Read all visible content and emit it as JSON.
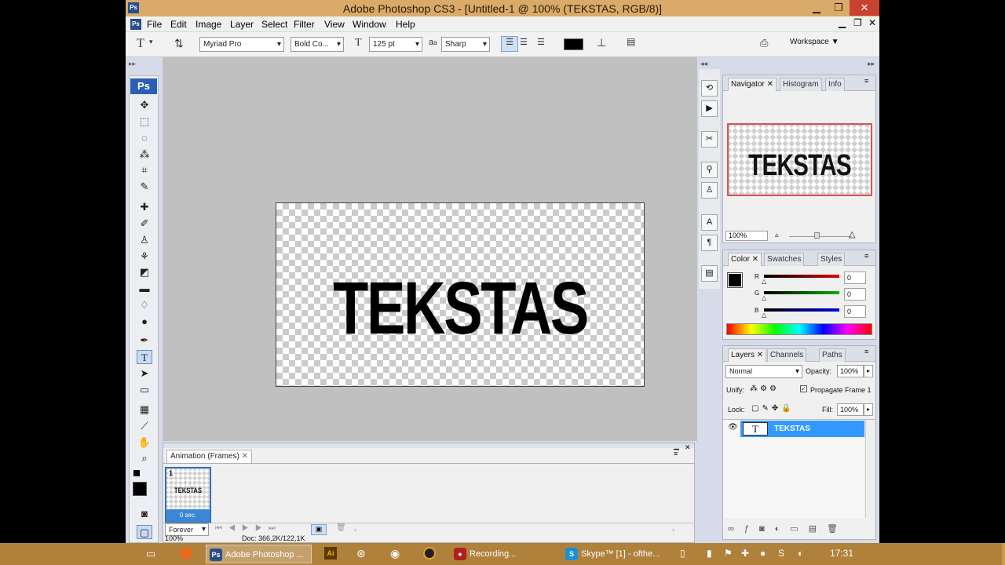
{
  "window": {
    "title": "Adobe Photoshop CS3 - [Untitled-1 @ 100% (TEKSTAS, RGB/8)]",
    "app_badge": "Ps",
    "min_glyph": "▁",
    "max_glyph": "❐",
    "close_glyph": "✕"
  },
  "menu": [
    "File",
    "Edit",
    "Image",
    "Layer",
    "Select",
    "Filter",
    "View",
    "Window",
    "Help"
  ],
  "options": {
    "font_family": "Myriad Pro",
    "font_style": "Bold Co...",
    "font_size": "125 pt",
    "aa_prefix": "a",
    "aa_suffix": "a",
    "antialias": "Sharp",
    "text_color": "#000000",
    "workspace": "Workspace ▼"
  },
  "tools_panel": {
    "logo": "Ps"
  },
  "canvas": {
    "text": "TEKSTAS"
  },
  "animation": {
    "tab_label": "Animation (Frames)",
    "frame_number": "1",
    "frame_thumb_text": "TEKSTAS",
    "frame_delay": "0 sec.",
    "loop": "Forever",
    "zoom": "100%",
    "doc_info": "Doc: 366,2K/122,1K"
  },
  "navigator": {
    "tabs": [
      "Navigator",
      "Histogram",
      "Info"
    ],
    "preview_text": "TEKSTAS",
    "zoom": "100%"
  },
  "color": {
    "tabs": [
      "Color",
      "Swatches",
      "Styles"
    ],
    "channels": [
      {
        "label": "R",
        "value": "0",
        "color": "#e00000"
      },
      {
        "label": "G",
        "value": "0",
        "color": "#00b000"
      },
      {
        "label": "B",
        "value": "0",
        "color": "#0000e0"
      }
    ]
  },
  "layers": {
    "tabs": [
      "Layers",
      "Channels",
      "Paths"
    ],
    "blend_mode": "Normal",
    "opacity_label": "Opacity:",
    "opacity": "100%",
    "unify_label": "Unify:",
    "propagate_label": "Propagate Frame 1",
    "lock_label": "Lock:",
    "fill_label": "Fill:",
    "fill": "100%",
    "items": [
      {
        "name": "TEKSTAS",
        "type_glyph": "T"
      }
    ]
  },
  "taskbar": {
    "tasks": [
      {
        "label": "Adobe Photoshop ...",
        "icon": "Ps",
        "color": "#2a4d8f"
      },
      {
        "label": "Recording...",
        "icon": "●",
        "color": "#b02020"
      },
      {
        "label": "Skype™ [1] - ofthe...",
        "icon": "S",
        "color": "#1a8fd8"
      }
    ],
    "clock": "17:31"
  }
}
